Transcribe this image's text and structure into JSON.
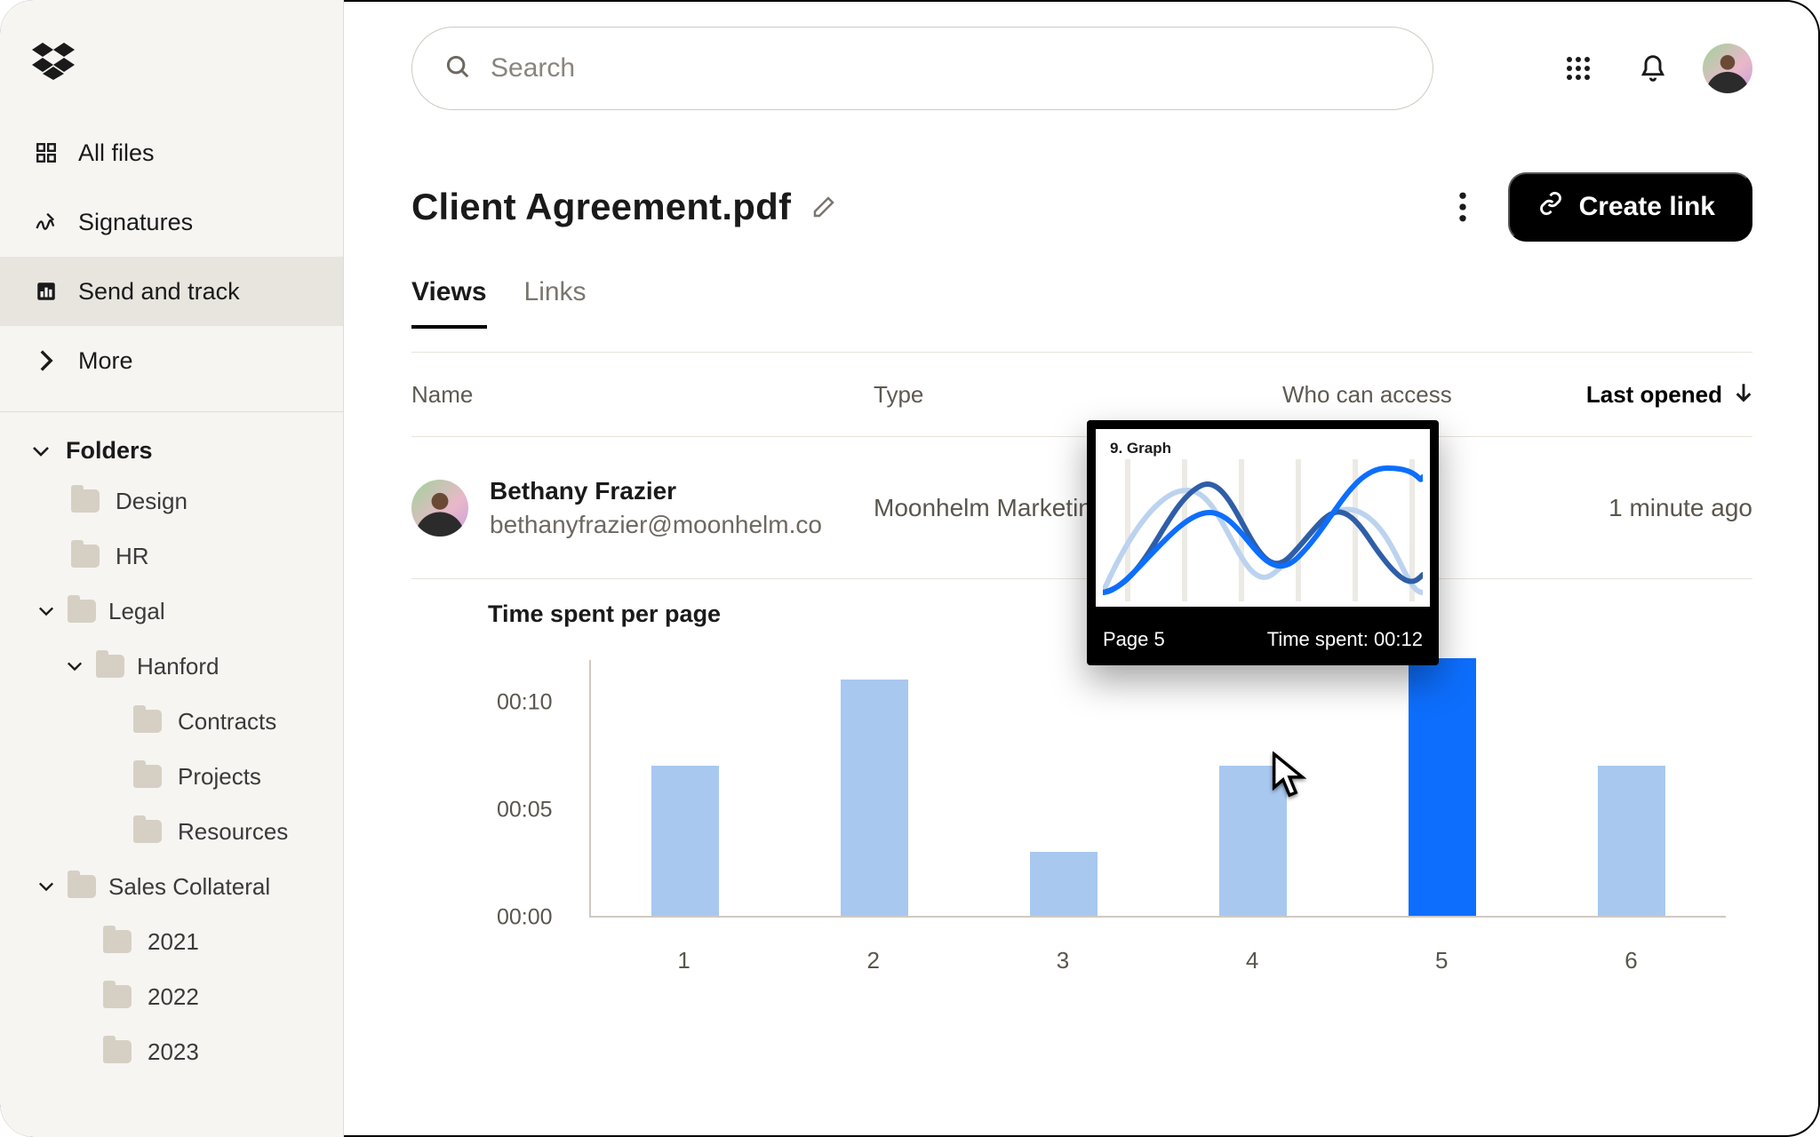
{
  "chart_data": {
    "type": "bar",
    "title": "Time spent per page",
    "categories": [
      "1",
      "2",
      "3",
      "4",
      "5",
      "6"
    ],
    "values_seconds": [
      7,
      11,
      3,
      7,
      12,
      7
    ],
    "highlight_index": 4,
    "xlabel": "",
    "ylabel": "",
    "y_ticks": [
      "00:00",
      "00:05",
      "00:10"
    ],
    "ylim_seconds": [
      0,
      12
    ]
  },
  "sidebar": {
    "nav": {
      "all_files": "All files",
      "signatures": "Signatures",
      "send_track": "Send and track",
      "more": "More"
    },
    "folders_header": "Folders",
    "folders": {
      "design": "Design",
      "hr": "HR",
      "legal": "Legal",
      "hanford": "Hanford",
      "contracts": "Contracts",
      "projects": "Projects",
      "resources": "Resources",
      "sales": "Sales Collateral",
      "y2021": "2021",
      "y2022": "2022",
      "y2023": "2023"
    }
  },
  "search": {
    "placeholder": "Search"
  },
  "header": {
    "title": "Client Agreement.pdf",
    "create_link": "Create link"
  },
  "tabs": {
    "views": "Views",
    "links": "Links"
  },
  "table": {
    "head": {
      "name": "Name",
      "type": "Type",
      "access": "Who can access",
      "opened": "Last opened"
    },
    "row": {
      "name": "Bethany Frazier",
      "email": "bethanyfrazier@moonhelm.co",
      "type": "Moonhelm Marketing",
      "opened": "1 minute ago"
    }
  },
  "preview": {
    "heading": "9. Graph",
    "page": "Page 5",
    "time": "Time spent: 00:12"
  }
}
